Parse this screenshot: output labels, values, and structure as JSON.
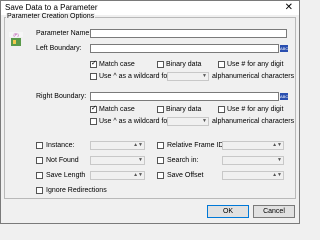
{
  "window": {
    "title": "Save Data to a Parameter",
    "close_glyph": "✕"
  },
  "group": {
    "label": "Parameter Creation Options"
  },
  "param_icon": {
    "name": "parameter-icon",
    "text": "{P}"
  },
  "param_name": {
    "label": "Parameter Name:",
    "value": ""
  },
  "left_boundary": {
    "label": "Left Boundary:",
    "value": "",
    "abc": "ABC",
    "match_case": {
      "label": "Match case",
      "checked": true
    },
    "binary": {
      "label": "Binary data",
      "checked": false
    },
    "hash": {
      "label": "Use # for any digit",
      "checked": false
    },
    "wildcard_pre": "Use ^ as a wildcard for",
    "wildcard_post": "alphanumerical characters"
  },
  "right_boundary": {
    "label": "Right Boundary:",
    "value": "",
    "abc": "ABC",
    "match_case": {
      "label": "Match case",
      "checked": true
    },
    "binary": {
      "label": "Binary data",
      "checked": false
    },
    "hash": {
      "label": "Use # for any digit",
      "checked": false
    },
    "wildcard_pre": "Use ^ as a wildcard for",
    "wildcard_post": "alphanumerical characters"
  },
  "options": {
    "instance": "Instance:",
    "not_found": "Not Found",
    "save_length": "Save Length",
    "ignore_redirections": "Ignore Redirections",
    "relative_frame_id": "Relative Frame ID:",
    "search_in": "Search in:",
    "save_offset": "Save Offset"
  },
  "buttons": {
    "ok": "OK",
    "cancel": "Cancel"
  }
}
